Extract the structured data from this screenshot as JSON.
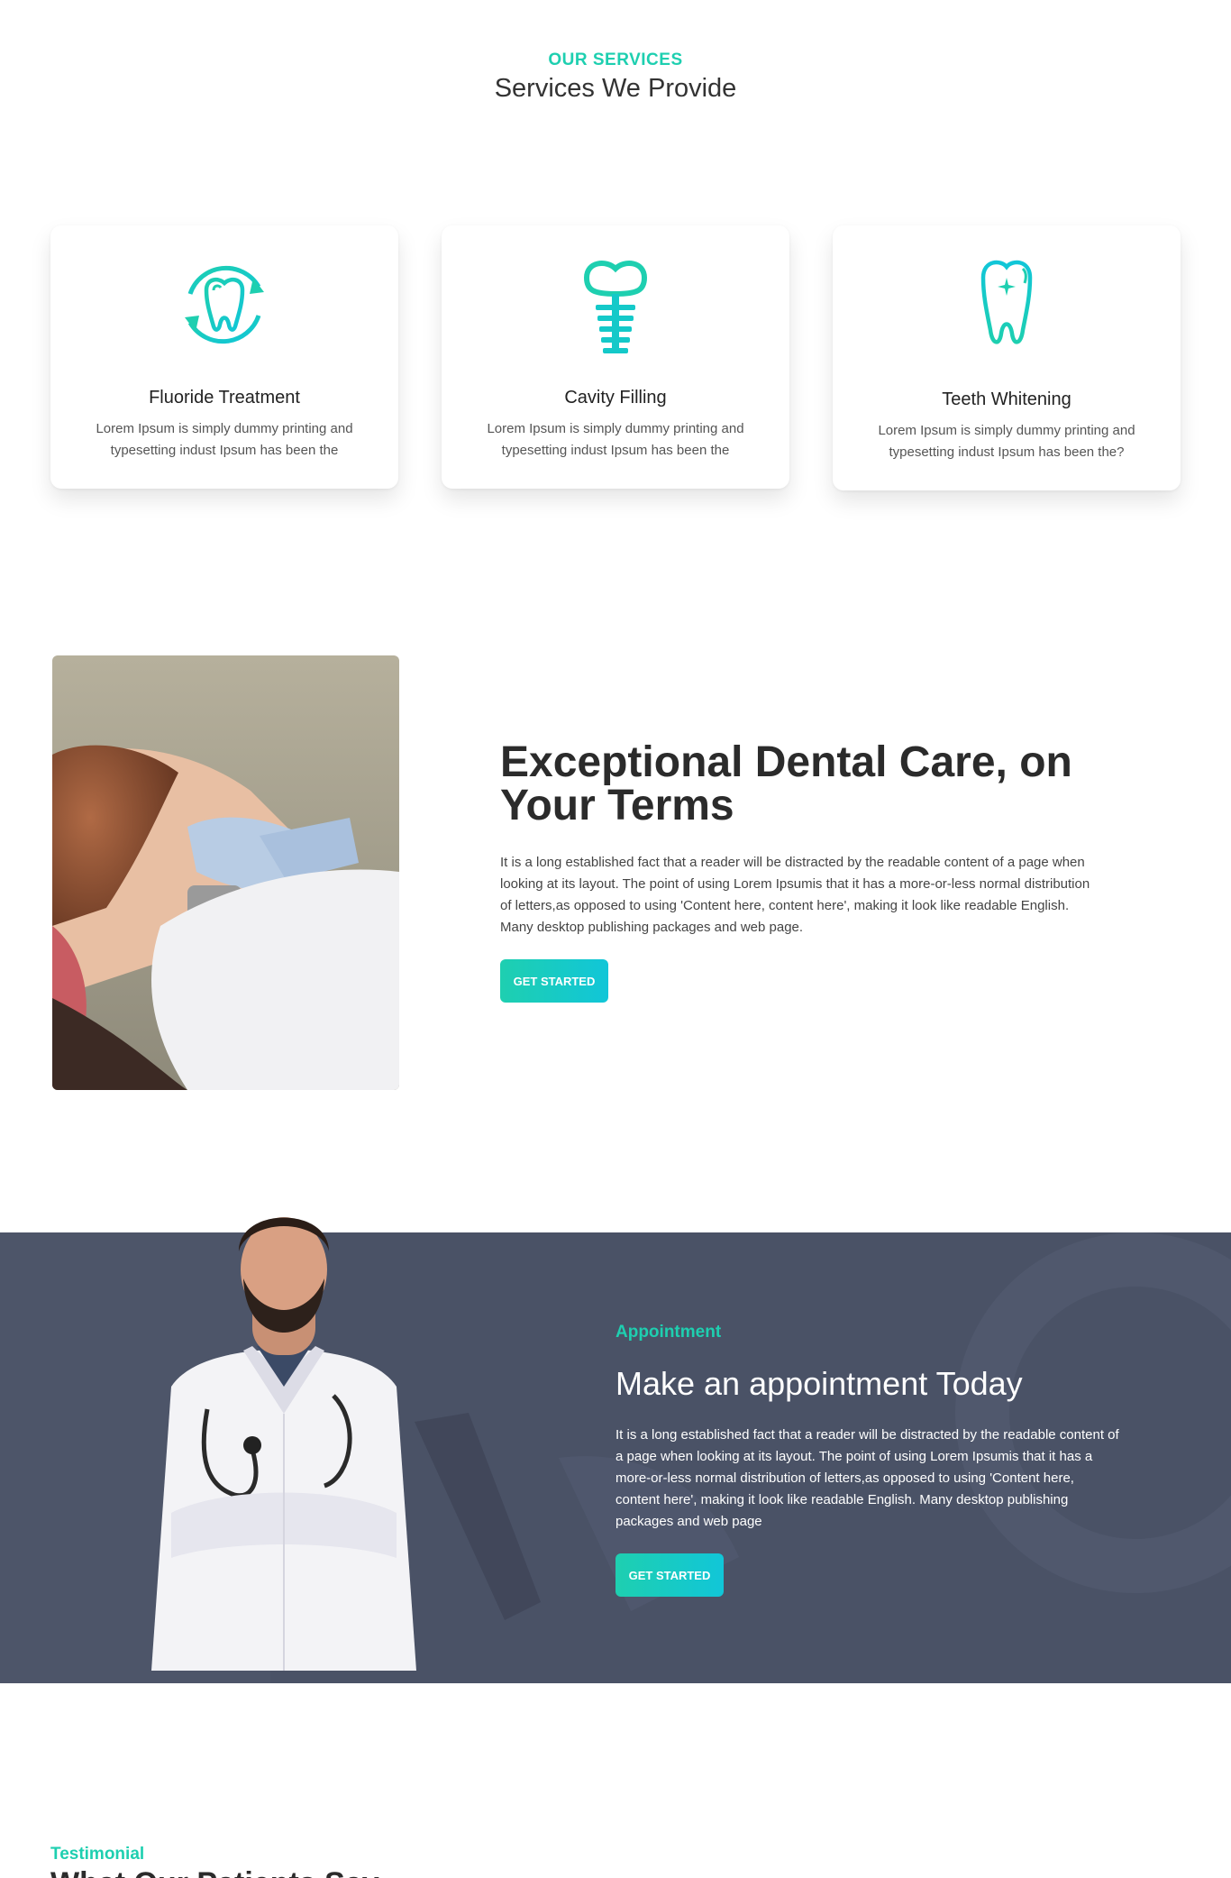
{
  "services": {
    "kicker": "OUR SERVICES",
    "title": "Services We Provide",
    "cards": [
      {
        "icon": "tooth-refresh-icon",
        "title": "Fluoride Treatment",
        "text": "Lorem Ipsum is simply dummy printing and typesetting indust Ipsum has been the"
      },
      {
        "icon": "dental-implant-icon",
        "title": "Cavity Filling",
        "text": "Lorem Ipsum is simply dummy printing and typesetting indust Ipsum has been the"
      },
      {
        "icon": "sparkle-tooth-icon",
        "title": "Teeth Whitening",
        "text": "Lorem Ipsum is simply dummy printing and typesetting indust Ipsum has been the?"
      }
    ]
  },
  "care": {
    "image": "dental-patient-photo",
    "title": "Exceptional Dental Care, on Your Terms",
    "text": "It is a long established fact that a reader will be distracted by the readable content of a page when looking at its layout. The point of using Lorem Ipsumis that it has a more-or-less normal distribution of letters,as opposed to using 'Content here, content here', making it look like readable English. Many desktop publishing packages and web page.",
    "button": "GET STARTED"
  },
  "appointment": {
    "image": "doctor-photo",
    "kicker": "Appointment",
    "title": "Make an appointment Today",
    "text": "It is a long established fact that a reader will be distracted by the readable content of a page when looking at its layout. The point of using Lorem Ipsumis that it has a more-or-less normal distribution of letters,as opposed to using 'Content here, content here', making it look like readable English. Many desktop publishing packages and web page",
    "button": "GET STARTED"
  },
  "testimonial": {
    "kicker": "Testimonial",
    "title": "What Our Patients Say"
  },
  "colors": {
    "accent": "#1ecfb0",
    "accent_alt": "#11c6d8",
    "appointment_bg": "#4a5266",
    "heading": "#2b2b2b"
  }
}
